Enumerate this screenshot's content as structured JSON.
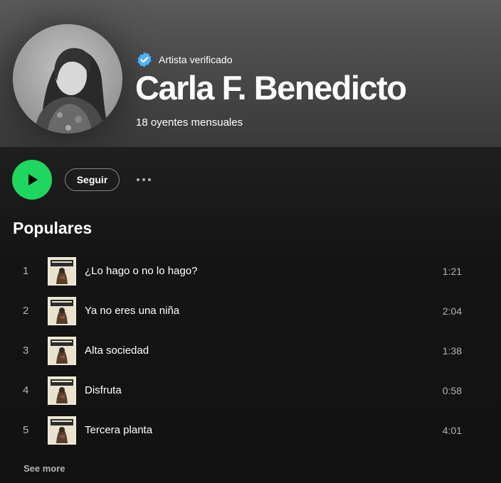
{
  "artist": {
    "verified_label": "Artista verificado",
    "name": "Carla F. Benedicto",
    "monthly_listeners": "18 oyentes mensuales"
  },
  "actions": {
    "follow_label": "Seguir"
  },
  "popular": {
    "title": "Populares",
    "tracks": [
      {
        "number": "1",
        "title": "¿Lo hago o no lo hago?",
        "duration": "1:21"
      },
      {
        "number": "2",
        "title": "Ya no eres una niña",
        "duration": "2:04"
      },
      {
        "number": "3",
        "title": "Alta sociedad",
        "duration": "1:38"
      },
      {
        "number": "4",
        "title": "Disfruta",
        "duration": "0:58"
      },
      {
        "number": "5",
        "title": "Tercera planta",
        "duration": "4:01"
      }
    ],
    "see_more_label": "See more"
  },
  "colors": {
    "play_green": "#1ed760",
    "verified_blue": "#4cb3ff",
    "background": "#121212",
    "secondary_text": "#b3b3b3"
  },
  "icons": {
    "verified": "verified-badge-icon",
    "play": "play-icon",
    "more": "more-options-icon"
  }
}
